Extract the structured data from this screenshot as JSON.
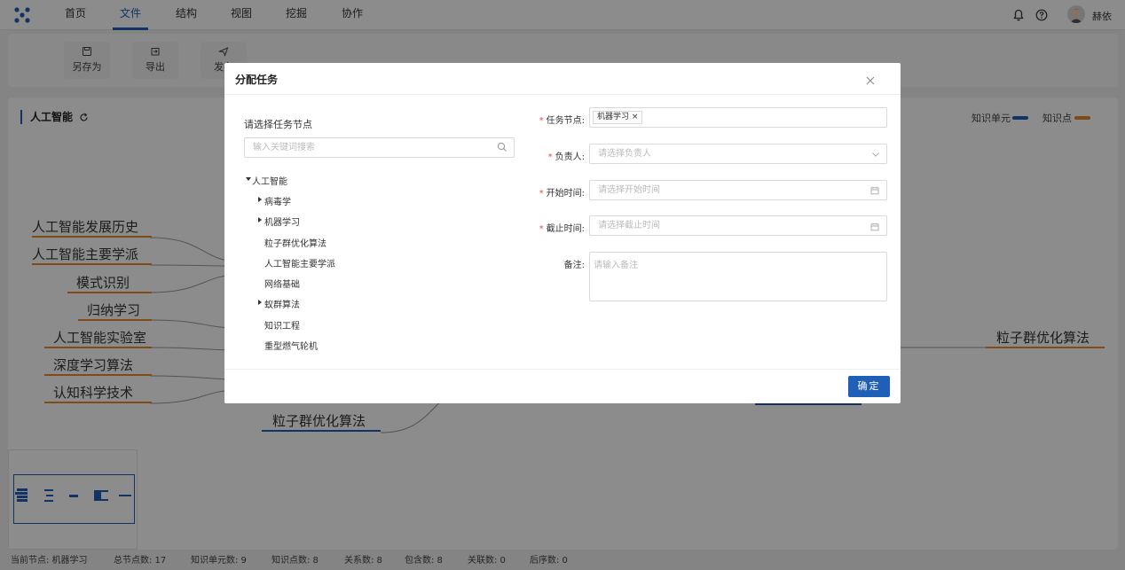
{
  "nav": {
    "items": [
      "首页",
      "文件",
      "结构",
      "视图",
      "挖掘",
      "协作"
    ],
    "active_index": 1,
    "username": "赫依"
  },
  "toolbar": {
    "buttons": [
      "另存为",
      "导出",
      "发布"
    ]
  },
  "map": {
    "title": "人工智能",
    "legend": {
      "unit_label": "知识单元",
      "unit_color": "#1f5fb8",
      "point_label": "知识点",
      "point_color": "#e8892f"
    },
    "left_nodes": [
      "人工智能发展历史",
      "人工智能主要学派",
      "模式识别",
      "归纳学习",
      "人工智能实验室",
      "深度学习算法",
      "认知科学技术"
    ],
    "bottom_node": "粒子群优化算法",
    "right_node": "粒子群优化算法"
  },
  "status": {
    "current_node": "当前节点: 机器学习",
    "total_nodes": "总节点数: 17",
    "unit_count": "知识单元数: 9",
    "point_count": "知识点数: 8",
    "relation_count": "关系数: 8",
    "contain_count": "包含数: 8",
    "link_count": "关联数: 0",
    "order_count": "后序数: 0"
  },
  "modal": {
    "title": "分配任务",
    "tree_heading": "请选择任务节点",
    "search_placeholder": "输入关键词搜索",
    "tree": {
      "root": "人工智能",
      "children": [
        {
          "label": "病毒学",
          "has_children": true
        },
        {
          "label": "机器学习",
          "has_children": true
        },
        {
          "label": "粒子群优化算法",
          "has_children": false
        },
        {
          "label": "人工智能主要学派",
          "has_children": false
        },
        {
          "label": "网络基础",
          "has_children": false
        },
        {
          "label": "蚁群算法",
          "has_children": true
        },
        {
          "label": "知识工程",
          "has_children": false
        },
        {
          "label": "重型燃气轮机",
          "has_children": false
        }
      ]
    },
    "form": {
      "task_node_label": "任务节点:",
      "task_node_tag": "机器学习",
      "assignee_label": "负责人:",
      "assignee_placeholder": "请选择负责人",
      "start_label": "开始时间:",
      "start_placeholder": "请选择开始时间",
      "end_label": "截止时间:",
      "end_placeholder": "请选择截止时间",
      "note_label": "备注:",
      "note_placeholder": "请输入备注"
    },
    "confirm_label": "确定"
  }
}
